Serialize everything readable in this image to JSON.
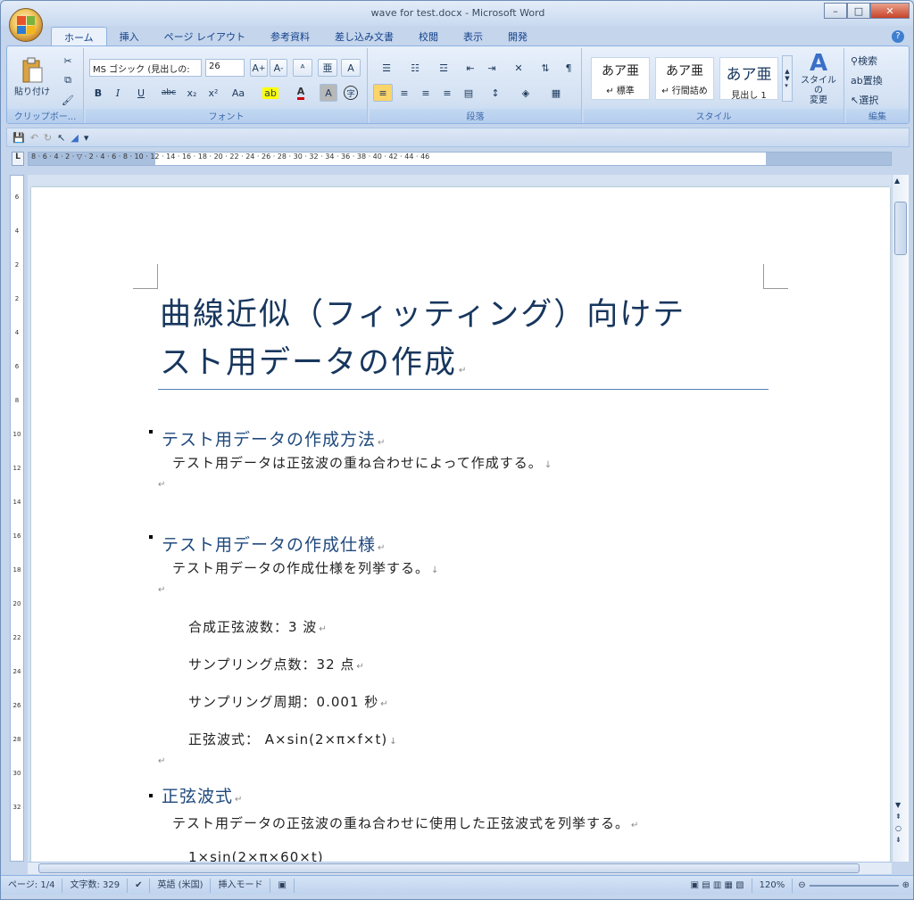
{
  "window": {
    "title": "wave for test.docx - Microsoft Word",
    "controls": {
      "minimize": "–",
      "maximize": "□",
      "close": "✕"
    }
  },
  "tabs": [
    "ホーム",
    "挿入",
    "ページ レイアウト",
    "参考資料",
    "差し込み文書",
    "校閲",
    "表示",
    "開発"
  ],
  "ribbon": {
    "clipboard": {
      "paste": "貼り付け",
      "label": "クリップボー..."
    },
    "font": {
      "name": "MS ゴシック (見出しの:",
      "size": "26",
      "bold": "B",
      "italic": "I",
      "underline": "U",
      "strike": "abc",
      "subscript": "x₂",
      "superscript": "x²",
      "case": "Aa",
      "color_letter": "A",
      "char_shade": "A",
      "enclose": "字",
      "label": "フォント"
    },
    "paragraph": {
      "label": "段落"
    },
    "styles": {
      "items": [
        {
          "sample": "あア亜",
          "name": "↵ 標準"
        },
        {
          "sample": "あア亜",
          "name": "↵ 行間詰め"
        },
        {
          "sample": "あア亜",
          "name": "見出し 1"
        }
      ],
      "change": "スタイルの\n変更",
      "label": "スタイル"
    },
    "editing": {
      "find": "検索",
      "replace": "置換",
      "select": "選択",
      "label": "編集"
    }
  },
  "ruler": {
    "h_labels": "8 · 6 · 4 · 2 · ▽ · 2 · 4 · 6 · 8 · 10 · 12 · 14 · 16 · 18 · 20 · 22 · 24 · 26 · 28 · 30 · 32 · 34 · 36 · 38 · 40 · 42 · 44 · 46",
    "v_labels": [
      "6",
      "4",
      "2",
      "2",
      "4",
      "6",
      "8",
      "10",
      "12",
      "14",
      "16",
      "18",
      "20",
      "22",
      "24",
      "26",
      "28",
      "30",
      "32"
    ]
  },
  "document": {
    "title_line1": "曲線近似（フィッティング）向けテ",
    "title_line2": "スト用データの作成",
    "sections": [
      {
        "heading": "テスト用データの作成方法",
        "body": "テスト用データは正弦波の重ね合わせによって作成する。"
      },
      {
        "heading": "テスト用データの作成仕様",
        "body": "テスト用データの作成仕様を列挙する。",
        "specs": [
          "合成正弦波数：3 波",
          "サンプリング点数：32 点",
          "サンプリング周期：0.001 秒",
          "正弦波式： A×sin(2×π×f×t)"
        ]
      },
      {
        "heading": "正弦波式",
        "body": "テスト用データの正弦波の重ね合わせに使用した正弦波式を列挙する。",
        "partial": "1×sin(2×π×60×t)"
      }
    ],
    "para_mark": "↵",
    "line_mark": "↓"
  },
  "status": {
    "page": "ページ: 1/4",
    "words": "文字数: 329",
    "language": "英語 (米国)",
    "mode": "挿入モード",
    "zoom": "120%"
  },
  "colors": {
    "heading": "#1f497d",
    "title": "#17365d",
    "accent": "#4f81bd"
  }
}
